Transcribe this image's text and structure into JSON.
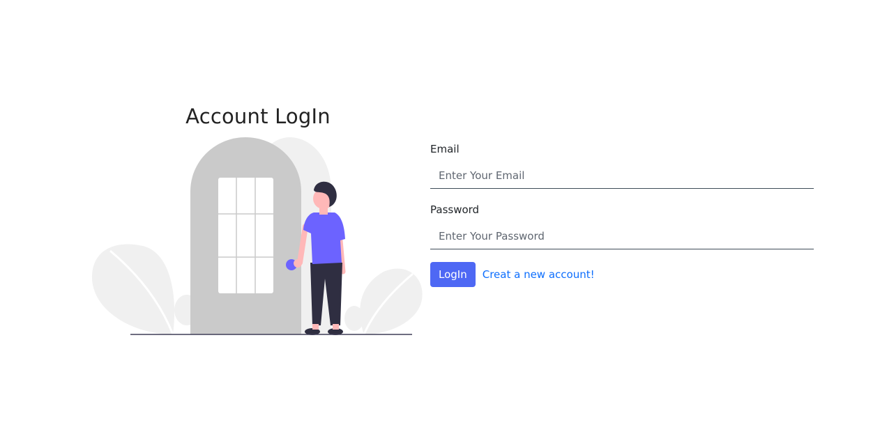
{
  "page": {
    "title": "Account LogIn"
  },
  "form": {
    "email_label": "Email",
    "email_placeholder": "Enter Your Email",
    "email_value": "",
    "password_label": "Password",
    "password_placeholder": "Enter Your Password",
    "password_value": "",
    "login_label": "LogIn",
    "register_link": "Creat a new account!"
  },
  "colors": {
    "accent": "#4e68f4",
    "link": "#0d6efd",
    "person_shirt": "#6c63ff",
    "door": "#cacaca",
    "plant": "#f0f0f0",
    "dark": "#2f2e41"
  },
  "illustration": {
    "icon": "door-person-illustration"
  }
}
